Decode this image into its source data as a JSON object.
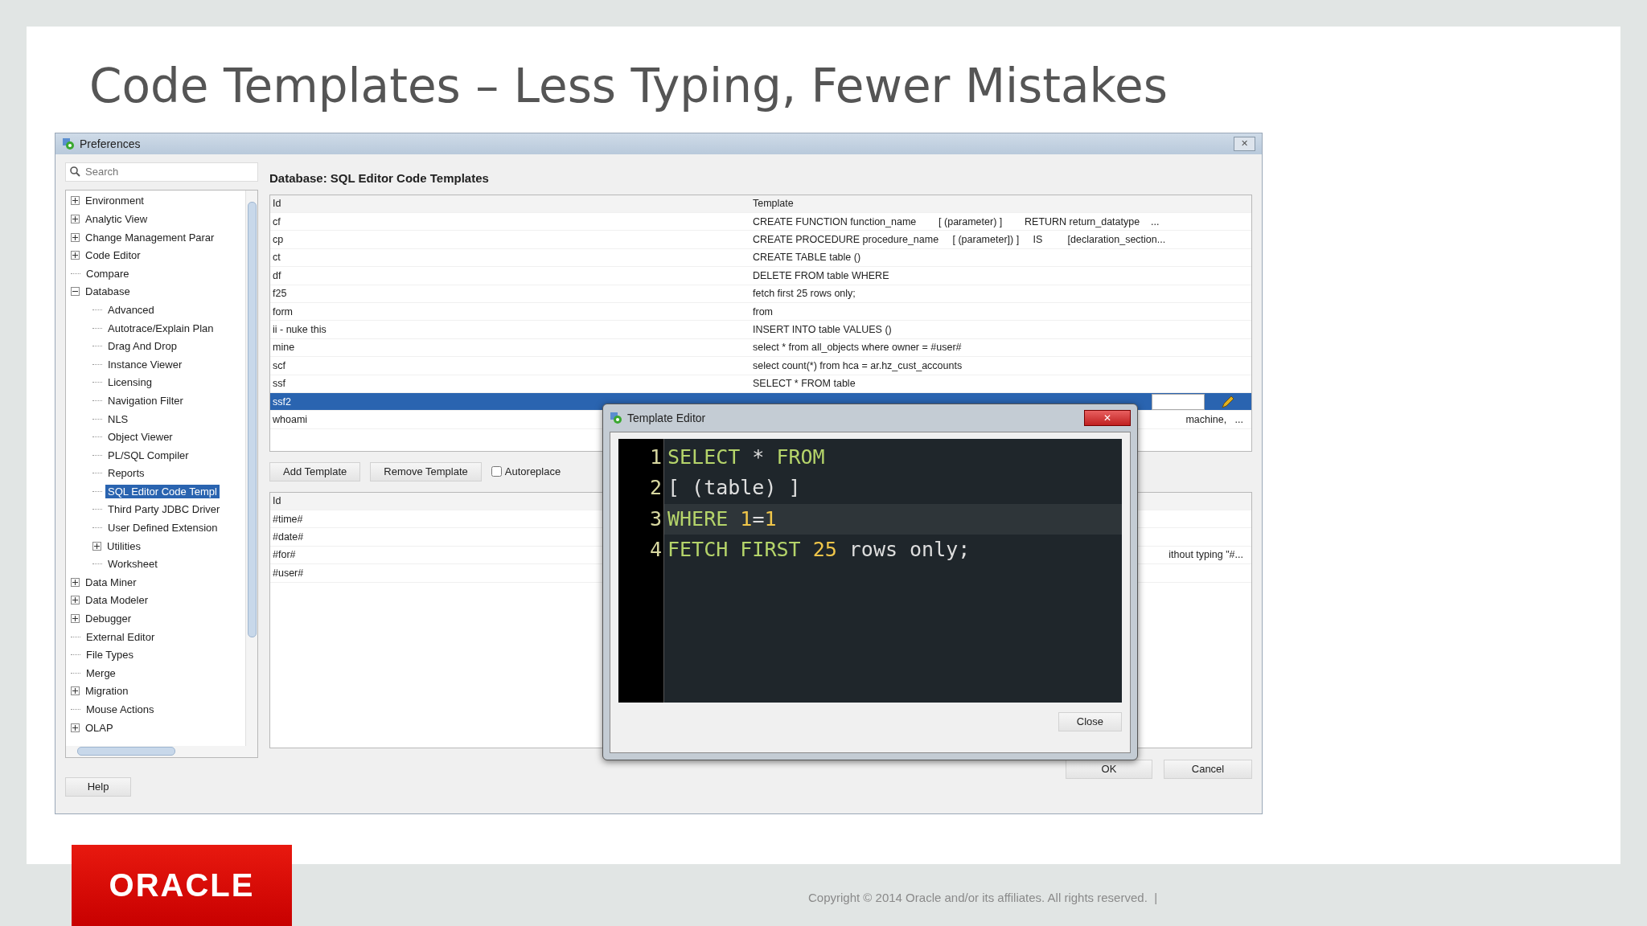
{
  "slide": {
    "title": "Code Templates – Less Typing, Fewer Mistakes",
    "copyright": "Copyright © 2014 Oracle and/or its affiliates. All rights reserved.  |",
    "logo": "ORACLE"
  },
  "window": {
    "title": "Preferences",
    "close": "✕"
  },
  "sidebar": {
    "search": {
      "placeholder": "Search"
    },
    "tree": [
      {
        "label": "Environment",
        "expanded": false,
        "selected": false
      },
      {
        "label": "Analytic View",
        "expanded": false,
        "selected": false
      },
      {
        "label": "Change Management Parar",
        "expanded": false,
        "selected": false
      },
      {
        "label": "Code Editor",
        "expanded": false,
        "selected": false
      },
      {
        "label": "Compare",
        "selected": false
      },
      {
        "label": "Database",
        "expanded": true,
        "selected": false,
        "children": [
          {
            "label": "Advanced",
            "selected": false
          },
          {
            "label": "Autotrace/Explain Plan",
            "selected": false
          },
          {
            "label": "Drag And Drop",
            "selected": false
          },
          {
            "label": "Instance Viewer",
            "selected": false
          },
          {
            "label": "Licensing",
            "selected": false
          },
          {
            "label": "Navigation Filter",
            "selected": false
          },
          {
            "label": "NLS",
            "selected": false
          },
          {
            "label": "Object Viewer",
            "selected": false
          },
          {
            "label": "PL/SQL Compiler",
            "selected": false
          },
          {
            "label": "Reports",
            "selected": false
          },
          {
            "label": "SQL Editor Code Templ",
            "selected": true
          },
          {
            "label": "Third Party JDBC Driver",
            "selected": false
          },
          {
            "label": "User Defined Extension",
            "selected": false
          },
          {
            "label": "Utilities",
            "expanded": false,
            "selected": false
          },
          {
            "label": "Worksheet",
            "selected": false
          }
        ]
      },
      {
        "label": "Data Miner",
        "expanded": false,
        "selected": false
      },
      {
        "label": "Data Modeler",
        "expanded": false,
        "selected": false
      },
      {
        "label": "Debugger",
        "expanded": false,
        "selected": false
      },
      {
        "label": "External Editor",
        "selected": false
      },
      {
        "label": "File Types",
        "selected": false
      },
      {
        "label": "Merge",
        "selected": false
      },
      {
        "label": "Migration",
        "expanded": false,
        "selected": false
      },
      {
        "label": "Mouse Actions",
        "selected": false
      },
      {
        "label": "OLAP",
        "expanded": false,
        "selected": false
      }
    ],
    "help_button": "Help"
  },
  "panel": {
    "heading": "Database: SQL Editor Code Templates",
    "templates": {
      "columns": [
        "Id",
        "Template"
      ],
      "rows": [
        {
          "id": "cf",
          "template": "CREATE FUNCTION function_name        [ (parameter) ]        RETURN return_datatype    ...",
          "selected": false
        },
        {
          "id": "cp",
          "template": "CREATE PROCEDURE procedure_name     [ (parameter]) ]     IS         [declaration_section...",
          "selected": false
        },
        {
          "id": "ct",
          "template": "CREATE TABLE table ()",
          "selected": false
        },
        {
          "id": "df",
          "template": "DELETE FROM table WHERE",
          "selected": false
        },
        {
          "id": "f25",
          "template": "fetch first 25 rows only;",
          "selected": false
        },
        {
          "id": "form",
          "template": "from",
          "selected": false
        },
        {
          "id": "ii - nuke this",
          "template": "INSERT INTO table VALUES ()",
          "selected": false
        },
        {
          "id": "mine",
          "template": "select * from all_objects where owner = #user#",
          "selected": false
        },
        {
          "id": "scf",
          "template": "select count(*) from hca = ar.hz_cust_accounts",
          "selected": false
        },
        {
          "id": "ssf",
          "template": "SELECT * FROM table",
          "selected": false
        },
        {
          "id": "ssf2",
          "template": "",
          "selected": true
        },
        {
          "id": "whoami",
          "template": "machine,   ...",
          "selected": false
        }
      ]
    },
    "buttons": [
      "Add Template",
      "Remove Template"
    ],
    "autoreplace": {
      "label": "Autoreplace",
      "checked": false
    },
    "variables": {
      "columns": [
        "Id"
      ],
      "rows": [
        {
          "id": "#time#",
          "description": ""
        },
        {
          "id": "#date#",
          "description": ""
        },
        {
          "id": "#for#",
          "description": "ithout typing \"#..."
        },
        {
          "id": "#user#",
          "description": ""
        }
      ]
    },
    "ok_button": "OK",
    "cancel_button": "Cancel"
  },
  "template_editor": {
    "title": "Template Editor",
    "close_button": "Close",
    "lines": [
      {
        "number": "1",
        "current": false,
        "tokens": [
          {
            "text": "SELECT",
            "kind": "keyword"
          },
          {
            "text": " * ",
            "kind": "plain"
          },
          {
            "text": "FROM",
            "kind": "keyword"
          }
        ]
      },
      {
        "number": "2",
        "current": false,
        "tokens": [
          {
            "text": "[ (table) ]",
            "kind": "plain"
          }
        ]
      },
      {
        "number": "3",
        "current": true,
        "tokens": [
          {
            "text": "WHERE ",
            "kind": "keyword"
          },
          {
            "text": "1",
            "kind": "number"
          },
          {
            "text": "=",
            "kind": "plain"
          },
          {
            "text": "1",
            "kind": "number"
          }
        ]
      },
      {
        "number": "4",
        "current": false,
        "tokens": [
          {
            "text": "FETCH FIRST ",
            "kind": "keyword"
          },
          {
            "text": "25",
            "kind": "number"
          },
          {
            "text": " rows only;",
            "kind": "plain"
          }
        ]
      }
    ]
  }
}
